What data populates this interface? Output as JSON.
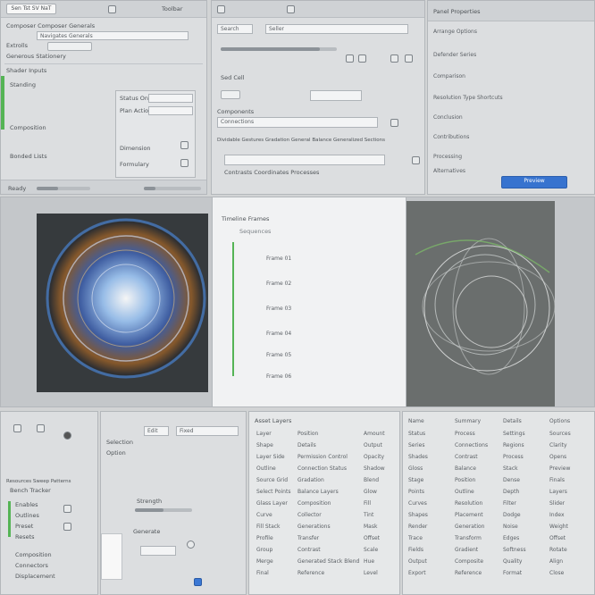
{
  "title": "Sen Tst SV NaT",
  "top_left": {
    "toolbar": "Toolbar",
    "header": "Composer Composer Generals",
    "row1": "Navigates  Generals",
    "row2": "Extrolls",
    "row3": "Generous Stationery",
    "panel_label": "Shader Inputs",
    "side1": "Standing",
    "side2": "Composition",
    "side3": "Bonded Lists",
    "box1": "Status One",
    "box2": "Plan Actions",
    "box3": "Dimension",
    "box4": "Formulary",
    "footer": "Ready"
  },
  "top_center": {
    "search": "Search",
    "tab": "Seller",
    "field_label": "Sed Cell",
    "section": "Components",
    "item1": "Connections",
    "row1": "Dividable Gestures Gradation General Balance Generalized Sections",
    "row2": "Contrasts Coordinates Processes"
  },
  "top_right": {
    "header": "Panel Properties",
    "items": [
      "Arrange Options",
      "Defender Series",
      "Comparison",
      "Resolution Type Shortcuts",
      "Conclusion",
      "Contributions",
      "Processing",
      "Alternatives"
    ],
    "highlight": "Preview"
  },
  "viewer": {
    "panel_title": "Timeline Frames",
    "subtitle": "Sequences",
    "frames": [
      "Frame 01",
      "Frame 02",
      "Frame 03",
      "Frame 04",
      "Frame 05",
      "Frame 06"
    ]
  },
  "bottom_left": {
    "header": "Resources Sweep Patterns",
    "group1": "Bench Tracker",
    "items": [
      "Enables",
      "Outlines",
      "Preset",
      "Resets"
    ],
    "labels": [
      "Composition",
      "Connectors",
      "Displacement"
    ]
  },
  "bottom_center": {
    "field1": "Edit",
    "field2": "Fixed",
    "label1": "Selection",
    "label2": "Option",
    "label3": "Generate",
    "slider_label": "Strength"
  },
  "bottom_list": {
    "header": "Asset Layers",
    "rows": [
      {
        "a": "Layer",
        "b": "Position",
        "c": "Amount"
      },
      {
        "a": "Shape",
        "b": "Details",
        "c": "Output"
      },
      {
        "a": "Layer Side",
        "b": "Permission Control",
        "c": "Opacity"
      },
      {
        "a": "Outline",
        "b": "Connection Status",
        "c": "Shadow"
      },
      {
        "a": "Source Grid",
        "b": "Gradation",
        "c": "Blend"
      },
      {
        "a": "Select Points",
        "b": "Balance Layers",
        "c": "Glow"
      },
      {
        "a": "Glass Layer",
        "b": "Composition",
        "c": "Fill"
      },
      {
        "a": "Curve",
        "b": "Collector",
        "c": "Tint"
      },
      {
        "a": "Fill Stack",
        "b": "Generations",
        "c": "Mask"
      },
      {
        "a": "Profile",
        "b": "Transfer",
        "c": "Offset"
      },
      {
        "a": "Group",
        "b": "Contrast",
        "c": "Scale"
      },
      {
        "a": "Merge",
        "b": "Generated Stack Blend",
        "c": "Hue"
      },
      {
        "a": "Final",
        "b": "Reference",
        "c": "Level"
      }
    ]
  },
  "bottom_right": {
    "headers": [
      "Name",
      "Summary",
      "Details",
      "Options"
    ],
    "rows": [
      [
        "Status",
        "Process",
        "Settings",
        "Sources"
      ],
      [
        "Series",
        "Connections",
        "Regions",
        "Clarity"
      ],
      [
        "Shades",
        "Contrast",
        "Process",
        "Opens"
      ],
      [
        "Gloss",
        "Balance",
        "Stack",
        "Preview"
      ],
      [
        "Stage",
        "Position",
        "Dense",
        "Finals"
      ],
      [
        "Points",
        "Outline",
        "Depth",
        "Layers"
      ],
      [
        "Curves",
        "Resolution",
        "Filter",
        "Slider"
      ],
      [
        "Shapes",
        "Placement",
        "Dodge",
        "Index"
      ],
      [
        "Render",
        "Generation",
        "Noise",
        "Weight"
      ],
      [
        "Trace",
        "Transform",
        "Edges",
        "Offset"
      ],
      [
        "Fields",
        "Gradient",
        "Softness",
        "Rotate"
      ],
      [
        "Output",
        "Composite",
        "Quality",
        "Align"
      ],
      [
        "Export",
        "Reference",
        "Format",
        "Close"
      ]
    ]
  },
  "colors": {
    "accent_blue": "#2f6fd0",
    "accent_green": "#3fae3f",
    "panel_bg": "#dcdee0"
  }
}
